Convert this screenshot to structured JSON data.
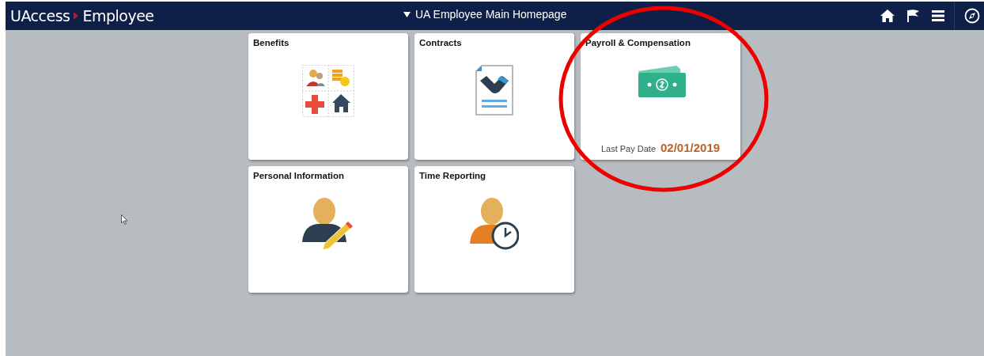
{
  "header": {
    "brand": "UAccess",
    "section": "Employee",
    "title": "UA Employee Main Homepage"
  },
  "tiles": [
    {
      "title": "Benefits",
      "kind": "benefits",
      "circled": false
    },
    {
      "title": "Contracts",
      "kind": "contracts",
      "circled": false
    },
    {
      "title": "Payroll & Compensation",
      "kind": "payroll",
      "circled": true,
      "detail_label": "Last Pay Date",
      "detail_value": "02/01/2019"
    },
    {
      "title": "Personal Information",
      "kind": "personal",
      "circled": false
    },
    {
      "title": "Time Reporting",
      "kind": "time",
      "circled": false
    }
  ]
}
